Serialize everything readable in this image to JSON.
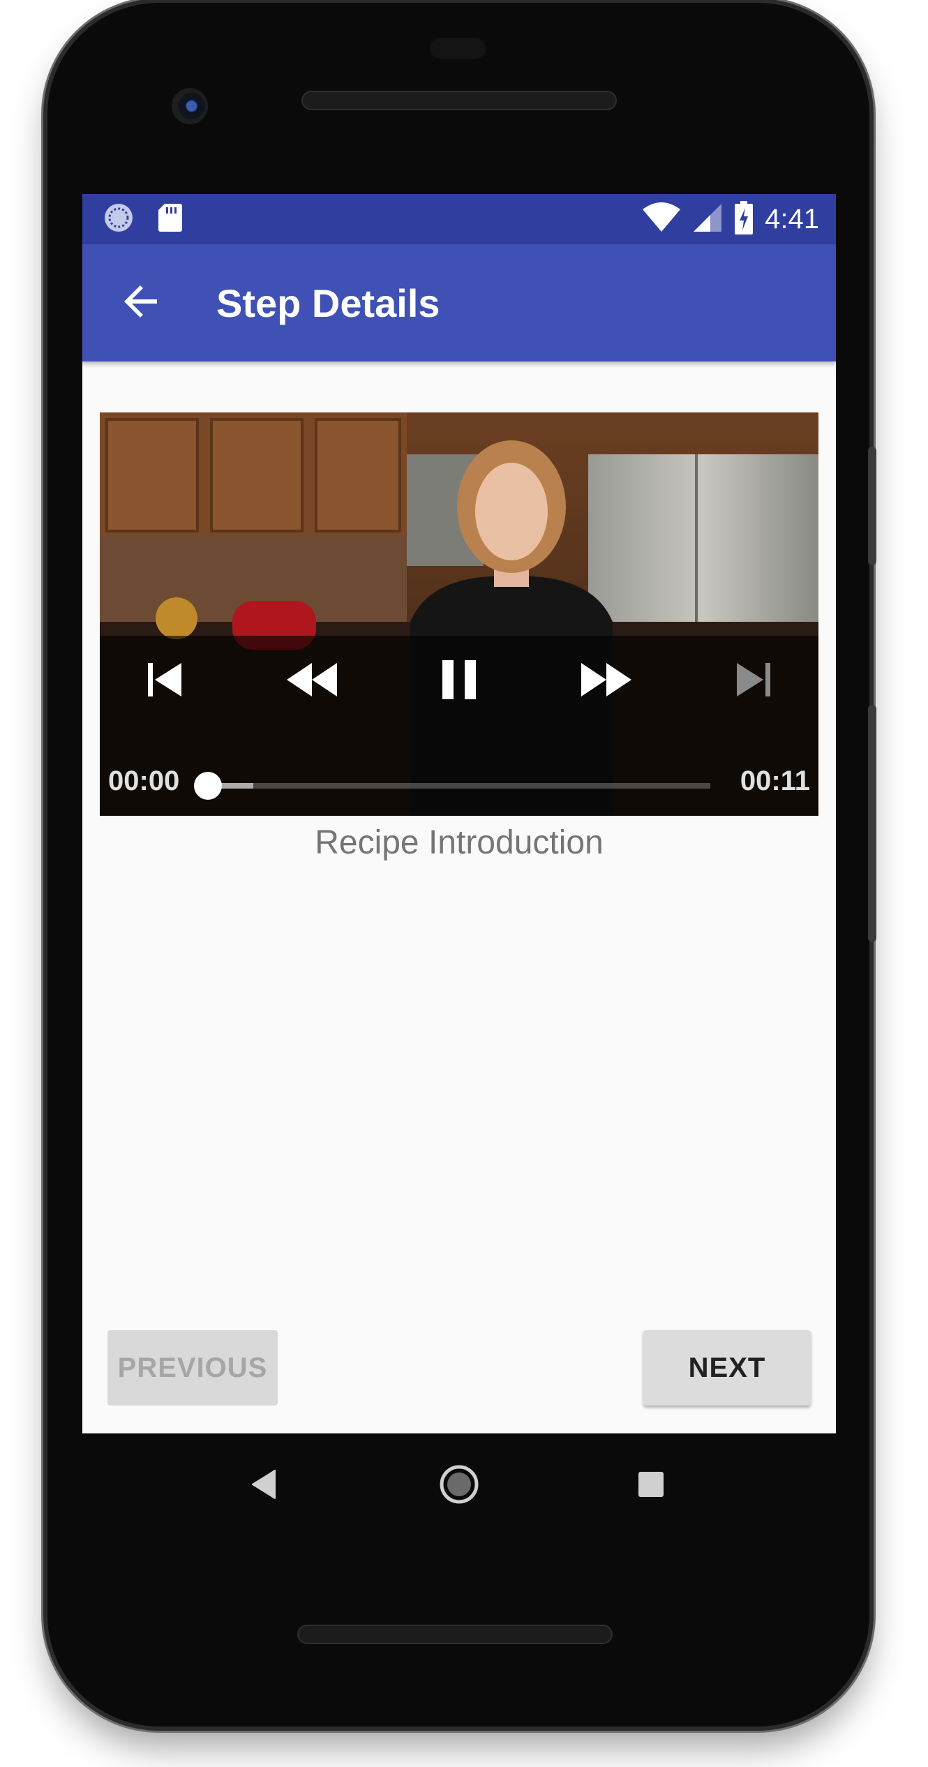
{
  "status_bar": {
    "time": "4:41",
    "icons": [
      "sync-icon",
      "sd-card-icon",
      "wifi-icon",
      "signal-icon",
      "battery-charging-icon"
    ]
  },
  "app_bar": {
    "title": "Step Details",
    "back_icon": "arrow-back-icon"
  },
  "player": {
    "controls": [
      "skip-previous-icon",
      "rewind-icon",
      "pause-icon",
      "fast-forward-icon",
      "skip-next-icon"
    ],
    "position": "00:00",
    "duration": "00:11",
    "progress_fraction": 0.0,
    "buffered_fraction": 0.09
  },
  "step": {
    "description": "Recipe Introduction"
  },
  "navigation": {
    "previous_label": "PREVIOUS",
    "previous_enabled": false,
    "next_label": "NEXT"
  },
  "system_nav": [
    "back-triangle-icon",
    "home-circle-icon",
    "recents-square-icon"
  ],
  "colors": {
    "primary": "#3f51b5",
    "primary_dark": "#303f9f",
    "background": "#fafafa"
  }
}
